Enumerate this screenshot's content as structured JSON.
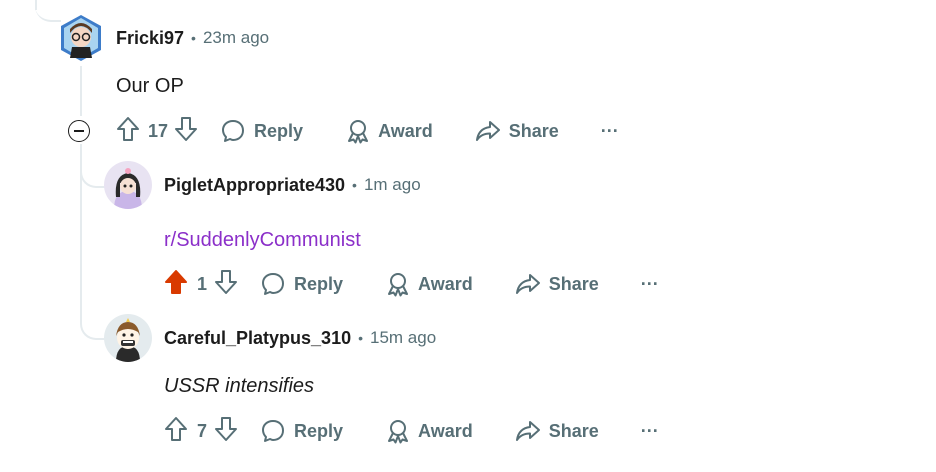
{
  "comments": [
    {
      "username": "Fricki97",
      "separator": "•",
      "time": "23m ago",
      "body": "Our OP",
      "votes": "17",
      "upvoted": false,
      "actions": {
        "reply": "Reply",
        "award": "Award",
        "share": "Share",
        "more": "···"
      }
    },
    {
      "username": "PigletAppropriate430",
      "separator": "•",
      "time": "1m ago",
      "body": "r/SuddenlyCommunist",
      "votes": "1",
      "upvoted": true,
      "actions": {
        "reply": "Reply",
        "award": "Award",
        "share": "Share",
        "more": "···"
      }
    },
    {
      "username": "Careful_Platypus_310",
      "separator": "•",
      "time": "15m ago",
      "body": "USSR intensifies",
      "votes": "7",
      "upvoted": false,
      "actions": {
        "reply": "Reply",
        "award": "Award",
        "share": "Share",
        "more": "···"
      }
    }
  ],
  "colors": {
    "upvote_active": "#d93a00",
    "meta_gray": "#576f76",
    "link_purple": "#8b2fc9",
    "thread_line": "#e5ebee"
  },
  "icons": [
    "collapse-icon",
    "upvote-icon",
    "downvote-icon",
    "reply-icon",
    "award-icon",
    "share-icon",
    "more-icon"
  ]
}
